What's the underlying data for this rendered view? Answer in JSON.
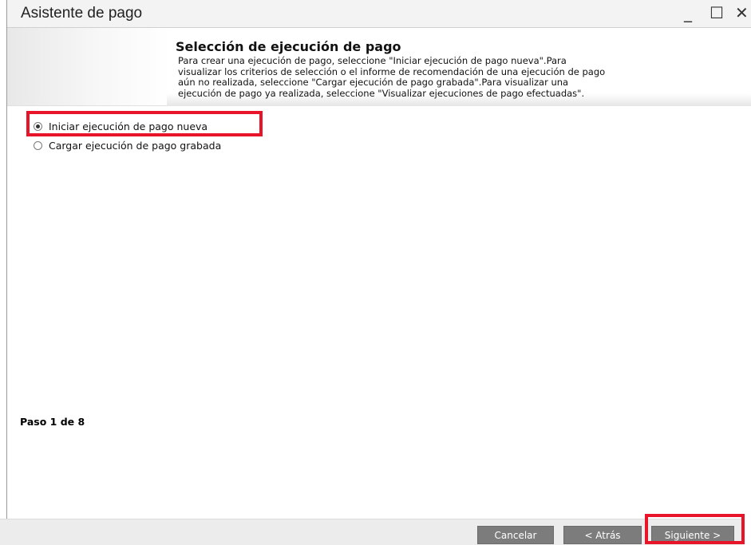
{
  "window": {
    "title": "Asistente de pago",
    "minimize_glyph": "_",
    "maximize_glyph": "☐",
    "close_glyph": "✕"
  },
  "header": {
    "heading": "Selección de ejecución de pago",
    "description": [
      "Para crear una ejecución de pago, seleccione \"Iniciar ejecución de pago nueva\".Para",
      "visualizar los criterios de selección o el informe de recomendación de una ejecución de pago",
      "aún no realizada, seleccione \"Cargar ejecución de pago grabada\".Para visualizar una",
      "ejecución de pago ya realizada, seleccione \"Visualizar ejecuciones de pago efectuadas\"."
    ]
  },
  "options": [
    {
      "label": "Iniciar ejecución de pago nueva",
      "selected": true
    },
    {
      "label": "Cargar ejecución de pago grabada",
      "selected": false
    }
  ],
  "step": "Paso 1 de 8",
  "buttons": {
    "cancel": "Cancelar",
    "back": "< Atrás",
    "next": "Siguiente >"
  },
  "colors": {
    "highlight": "#e8142a",
    "button": "#7c7c7c"
  }
}
